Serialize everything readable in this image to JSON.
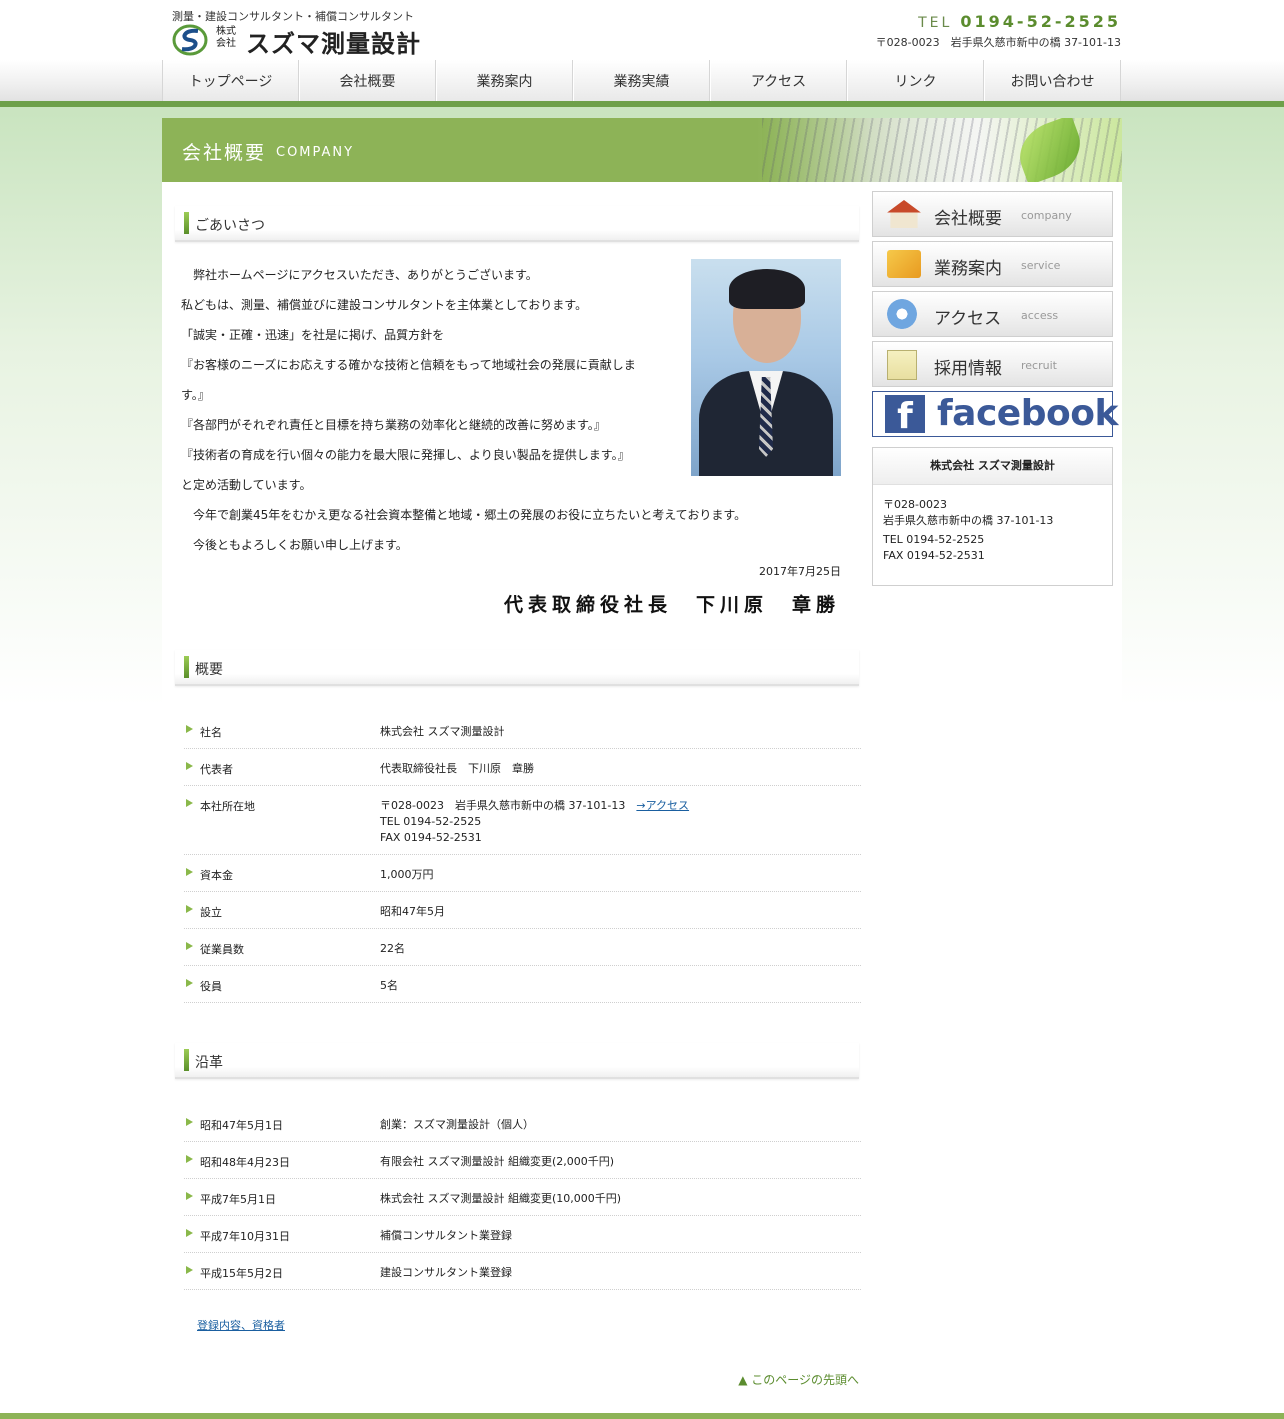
{
  "header": {
    "tagline": "測量・建設コンサルタント・補償コンサルタント",
    "logo_kabu": "株式会社",
    "logo_name": "スズマ測量設計",
    "tel_label": "TEL",
    "tel_number": "0194-52-2525",
    "address": "〒028-0023　岩手県久慈市新中の橋 37-101-13"
  },
  "nav": {
    "items": [
      "トップページ",
      "会社概要",
      "業務案内",
      "業務実績",
      "アクセス",
      "リンク",
      "お問い合わせ"
    ]
  },
  "banner": {
    "title_jp": "会社概要",
    "title_en": "COMPANY"
  },
  "greeting": {
    "heading": "ごあいさつ",
    "lines": [
      "　弊社ホームページにアクセスいただき、ありがとうございます。",
      "私どもは、測量、補償並びに建設コンサルタントを主体業としております。",
      "「誠実・正確・迅速」を社是に掲げ、品質方針を",
      "『お客様のニーズにお応えする確かな技術と信頼をもって地域社会の発展に貢献しま",
      "す。』",
      "『各部門がそれぞれ責任と目標を持ち業務の効率化と継続的改善に努めます。』",
      "『技術者の育成を行い個々の能力を最大限に発揮し、より良い製品を提供します。』",
      "と定め活動しています。",
      "　今年で創業45年をむかえ更なる社会資本整備と地域・郷土の発展のお役に立ちたいと考えております。",
      "　今後ともよろしくお願い申し上げます。"
    ],
    "date": "2017年7月25日",
    "signature": "代表取締役社長　下川原　章勝"
  },
  "overview": {
    "heading": "概要",
    "rows": [
      {
        "label": "社名",
        "value": "株式会社 スズマ測量設計"
      },
      {
        "label": "代表者",
        "value": "代表取締役社長　下川原　章勝"
      },
      {
        "label": "本社所在地",
        "value": "〒028-0023　岩手県久慈市新中の橋 37-101-13",
        "link": "→アクセス",
        "tel": "TEL 0194-52-2525",
        "fax": "FAX 0194-52-2531"
      },
      {
        "label": "資本金",
        "value": "1,000万円"
      },
      {
        "label": "設立",
        "value": "昭和47年5月"
      },
      {
        "label": "従業員数",
        "value": "22名"
      },
      {
        "label": "役員",
        "value": "5名"
      }
    ]
  },
  "history": {
    "heading": "沿革",
    "rows": [
      {
        "label": "昭和47年5月1日",
        "value": "創業：スズマ測量設計（個人）"
      },
      {
        "label": "昭和48年4月23日",
        "value": "有限会社 スズマ測量設計 組織変更(2,000千円)"
      },
      {
        "label": "平成7年5月1日",
        "value": "株式会社 スズマ測量設計 組織変更(10,000千円)"
      },
      {
        "label": "平成7年10月31日",
        "value": "補償コンサルタント業登録"
      },
      {
        "label": "平成15年5月2日",
        "value": "建設コンサルタント業登録"
      }
    ],
    "registration_link": "登録内容、資格者"
  },
  "page_top": "▲ このページの先頭へ",
  "sidebar": {
    "buttons": [
      {
        "jp": "会社概要",
        "en": "company",
        "icon": "house-icon"
      },
      {
        "jp": "業務案内",
        "en": "service",
        "icon": "pencil-icon"
      },
      {
        "jp": "アクセス",
        "en": "access",
        "icon": "compass-icon"
      },
      {
        "jp": "採用情報",
        "en": "recruit",
        "icon": "document-icon"
      }
    ],
    "facebook_f": "f",
    "facebook_text": "facebook",
    "info": {
      "title": "株式会社 スズマ測量設計",
      "zip": "〒028-0023",
      "addr": "岩手県久慈市新中の橋 37-101-13",
      "tel": "TEL 0194-52-2525",
      "fax": "FAX 0194-52-2531"
    }
  },
  "colors": {
    "accent_green": "#8db357",
    "nav_line": "#6ea04a",
    "link_blue": "#1a5fa0",
    "facebook_blue": "#3b5998"
  }
}
